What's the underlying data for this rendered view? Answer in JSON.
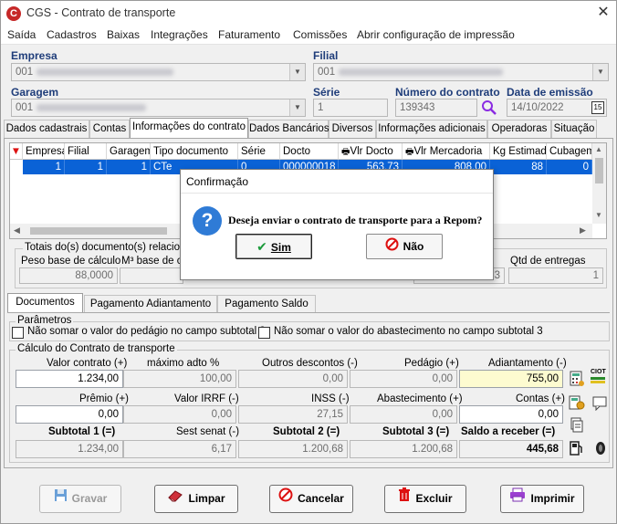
{
  "window": {
    "title": "CGS - Contrato de transporte",
    "app_icon": "C"
  },
  "menu": [
    "Saída",
    "Cadastros",
    "Baixas",
    "Integrações",
    "Faturamento",
    "Comissões",
    "Abrir configuração de impressão"
  ],
  "header": {
    "empresa_label": "Empresa",
    "empresa_value": "001",
    "filial_label": "Filial",
    "filial_value": "001",
    "garagem_label": "Garagem",
    "garagem_value": "001",
    "serie_label": "Série",
    "serie_value": "1",
    "numero_label": "Número do contrato",
    "numero_value": "139343",
    "data_label": "Data de emissão",
    "data_value": "14/10/2022",
    "calendar_day": "15"
  },
  "main_tabs": [
    "Dados cadastrais",
    "Contas",
    "Informações do contrato",
    "Dados Bancários",
    "Diversos",
    "Informações adicionais",
    "Operadoras",
    "Situação"
  ],
  "grid": {
    "columns": [
      "Empresa",
      "Filial",
      "Garagem",
      "Tipo documento",
      "Série",
      "Docto",
      "Vlr Docto",
      "Vlr Mercadoria",
      "Kg Estimado",
      "Cubagem"
    ],
    "row": [
      "1",
      "1",
      "1",
      "CTe",
      "0",
      "000000018",
      "563,73",
      "808,00",
      "88",
      "0"
    ]
  },
  "totals": {
    "group_title": "Totais do(s) documento(s) relacionad",
    "peso_label": "Peso base de cálculo",
    "peso_value": "88,0000",
    "m3_label": "M³ base de cálc",
    "vlr_partial": "73",
    "qtd_label": "Qtd de entregas",
    "qtd_value": "1"
  },
  "sub_tabs": [
    "Documentos",
    "Pagamento Adiantamento",
    "Pagamento Saldo"
  ],
  "params": {
    "title": "Parâmetros",
    "check1": "Não somar o valor do pedágio no campo subtotal 3",
    "check2": "Não somar o valor do abastecimento no campo subtotal 3"
  },
  "calc": {
    "title": "Cálculo do Contrato de transporte",
    "valor_contrato_label": "Valor contrato (+)",
    "valor_contrato": "1.234,00",
    "max_adto_label": "máximo adto %",
    "max_adto": "100,00",
    "outros_label": "Outros descontos (-)",
    "outros": "0,00",
    "pedagio_label": "Pedágio (+)",
    "pedagio": "0,00",
    "adiantamento_label": "Adiantamento (-)",
    "adiantamento": "755,00",
    "premio_label": "Prêmio (+)",
    "premio": "0,00",
    "irrf_label": "Valor IRRF (-)",
    "irrf": "0,00",
    "inss_label": "INSS (-)",
    "inss": "27,15",
    "abastecimento_label": "Abastecimento (+)",
    "abastecimento": "0,00",
    "contas_label": "Contas (+)",
    "contas": "0,00",
    "subtotal1_label": "Subtotal 1 (=)",
    "subtotal1": "1.234,00",
    "sest_label": "Sest senat (-)",
    "sest": "6,17",
    "subtotal2_label": "Subtotal 2 (=)",
    "subtotal2": "1.200,68",
    "subtotal3_label": "Subtotal 3 (=)",
    "subtotal3": "1.200,68",
    "saldo_label": "Saldo a receber (=)",
    "saldo": "445,68",
    "ciot_label": "CIOT"
  },
  "buttons": {
    "gravar": "Gravar",
    "limpar": "Limpar",
    "cancelar": "Cancelar",
    "excluir": "Excluir",
    "imprimir": "Imprimir"
  },
  "dialog": {
    "title": "Confirmação",
    "message": "Deseja enviar o contrato de transporte para a Repom?",
    "yes": "Sim",
    "no": "Não"
  },
  "colors": {
    "accent": "#0a62d6",
    "label": "#1f3d7a",
    "highlight": "#fdfbd0"
  }
}
